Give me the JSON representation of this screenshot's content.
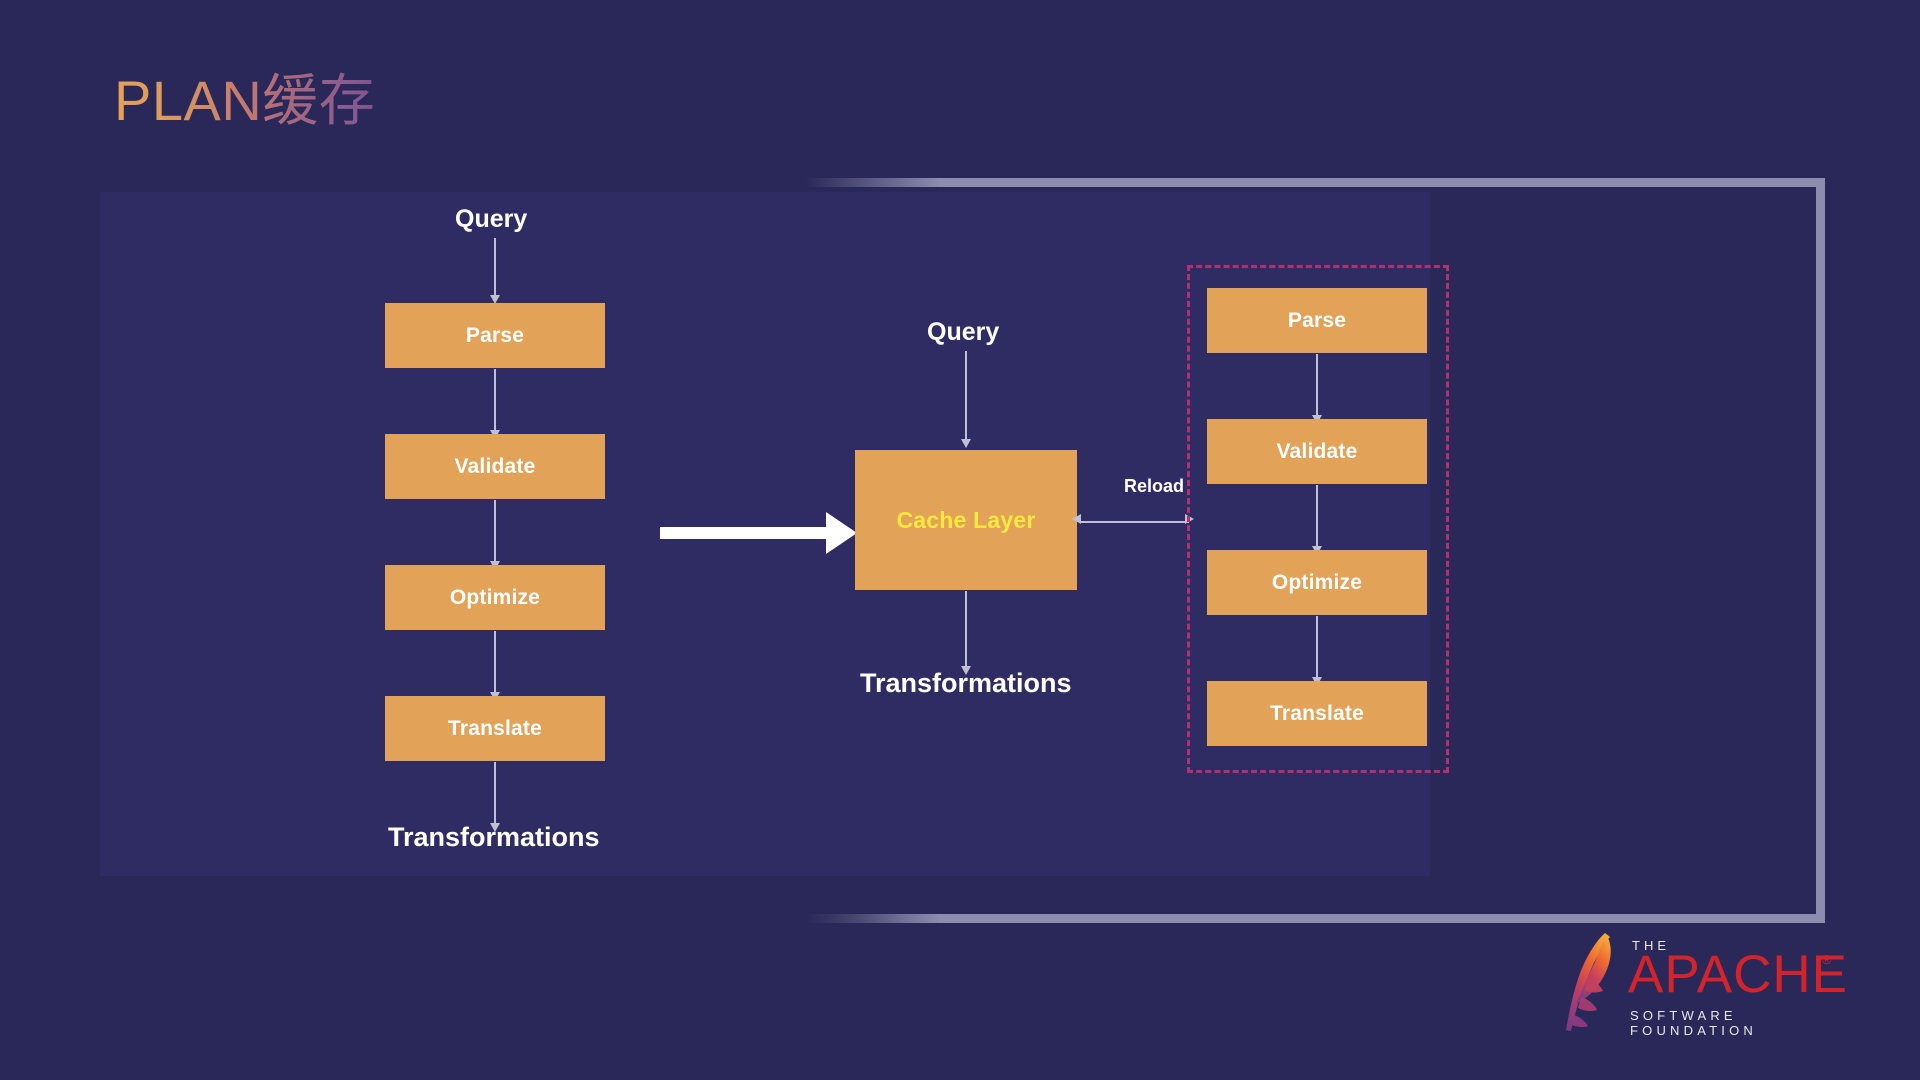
{
  "slide": {
    "title": "PLAN缓存",
    "background_color": "#2A2858",
    "panel_color": "#2E2C63",
    "box_color": "#E2A258",
    "accent_yellow": "#FFE93F",
    "dashed_border_color": "#B3306E",
    "frame_color": "#8C8CAE"
  },
  "left_pipeline": {
    "input_label": "Query",
    "output_label": "Transformations",
    "steps": [
      {
        "label": "Parse"
      },
      {
        "label": "Validate"
      },
      {
        "label": "Optimize"
      },
      {
        "label": "Translate"
      }
    ]
  },
  "center_pipeline": {
    "input_label": "Query",
    "output_label": "Transformations",
    "cache_label": "Cache Layer"
  },
  "connector": {
    "reload_label": "Reload"
  },
  "right_pipeline": {
    "steps": [
      {
        "label": "Parse"
      },
      {
        "label": "Validate"
      },
      {
        "label": "Optimize"
      },
      {
        "label": "Translate"
      }
    ]
  },
  "logo": {
    "the": "THE",
    "name": "APACHE",
    "registered": "®",
    "tagline": "SOFTWARE FOUNDATION"
  }
}
